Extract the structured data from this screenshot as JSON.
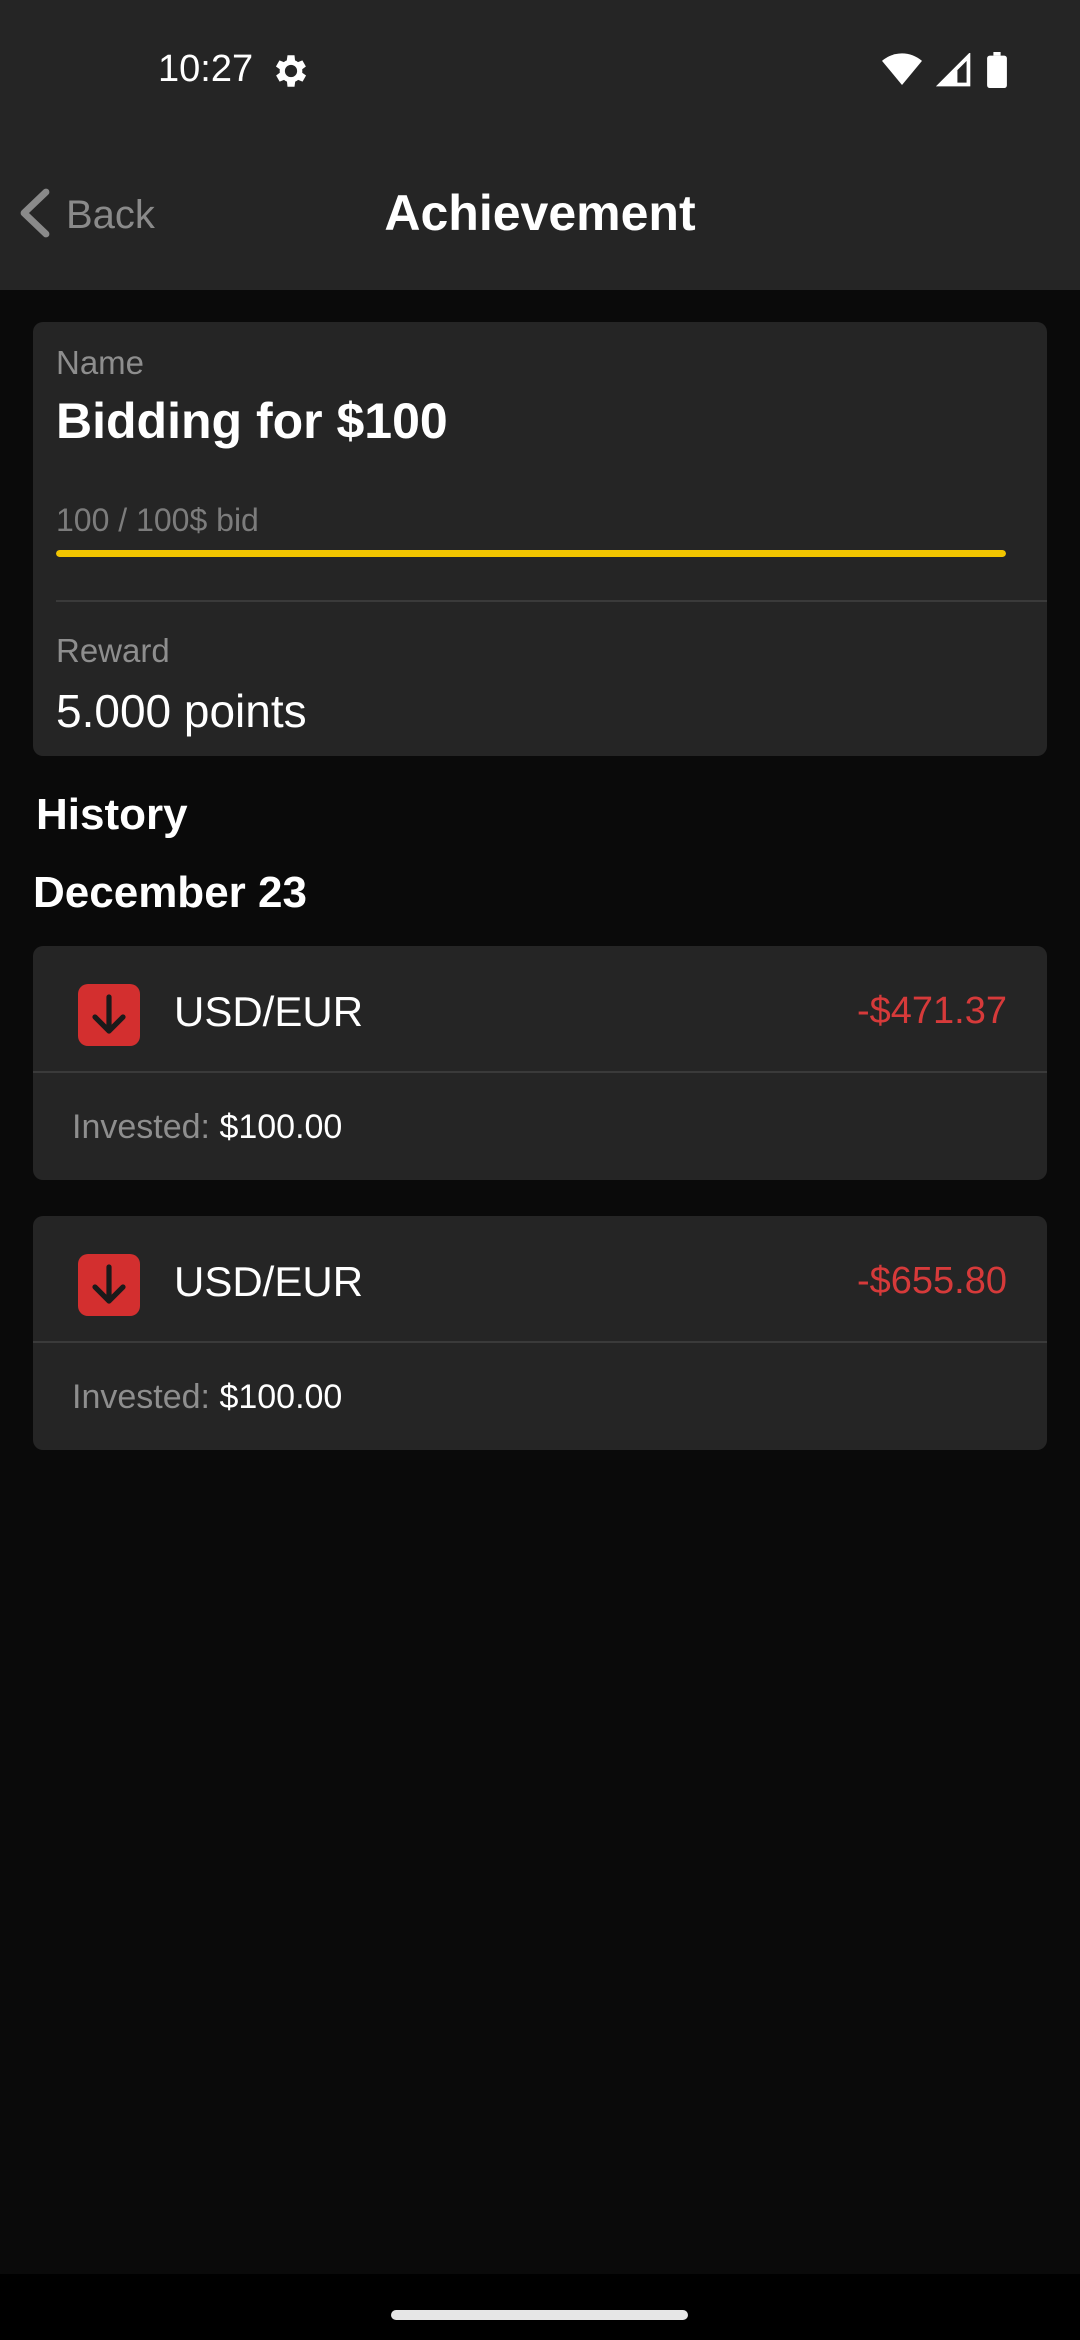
{
  "status_bar": {
    "time": "10:27",
    "icons": [
      "settings-gear-icon",
      "wifi-icon",
      "cellular-signal-icon",
      "battery-icon"
    ]
  },
  "app_bar": {
    "back_label": "Back",
    "title": "Achievement"
  },
  "achievement": {
    "name_label": "Name",
    "name": "Bidding for $100",
    "progress_text": "100 / 100$ bid",
    "progress_fraction": 1.0,
    "progress_color": "#f2c500",
    "reward_label": "Reward",
    "reward": "5.000 points"
  },
  "history": {
    "title": "History",
    "date": "December 23",
    "items": [
      {
        "icon": "arrow-down-icon",
        "pair": "USD/EUR",
        "pnl": "-$471.37",
        "invested_label": "Invested:",
        "invested_value": "$100.00"
      },
      {
        "icon": "arrow-down-icon",
        "pair": "USD/EUR",
        "pnl": "-$655.80",
        "invested_label": "Invested:",
        "invested_value": "$100.00"
      }
    ]
  },
  "colors": {
    "background": "#0a0a0a",
    "surface": "#252525",
    "loss": "#d63a3a",
    "loss_icon_bg": "#d32f2f",
    "accent": "#f2c500"
  }
}
